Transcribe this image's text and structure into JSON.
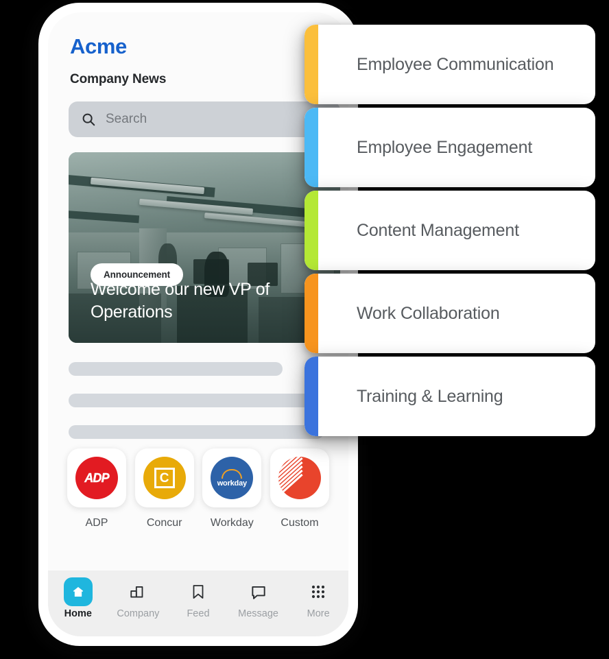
{
  "phone": {
    "app": {
      "brand": "Acme",
      "page_title": "Company News",
      "search": {
        "placeholder": "Search",
        "icon": "search-icon"
      },
      "hero": {
        "badge": "Announcement",
        "title": "Welcome our new VP of Operations",
        "image_description": "open-plan office interior, desaturated teal tint"
      },
      "skeleton_rows": 3,
      "apps": [
        {
          "label": "ADP",
          "logo": "adp-logo",
          "color": "#e21b22"
        },
        {
          "label": "Concur",
          "logo": "concur-logo",
          "color": "#e8aa09"
        },
        {
          "label": "Workday",
          "logo": "workday-logo",
          "color": "#2d62a8"
        },
        {
          "label": "Custom",
          "logo": "custom-logo",
          "color": "#e8442c"
        }
      ],
      "bottom_nav": {
        "active_index": 0,
        "active_color": "#1fb6de",
        "items": [
          {
            "label": "Home",
            "icon": "home-icon"
          },
          {
            "label": "Company",
            "icon": "building-icon"
          },
          {
            "label": "Feed",
            "icon": "bookmark-icon"
          },
          {
            "label": "Message",
            "icon": "chat-bubble-icon"
          },
          {
            "label": "More",
            "icon": "grid-dots-icon"
          }
        ]
      }
    }
  },
  "feature_cards": [
    {
      "label": "Employee Communication",
      "accent": "#fbbf3c"
    },
    {
      "label": "Employee Engagement",
      "accent": "#4cb9f5"
    },
    {
      "label": "Content Management",
      "accent": "#b4e835"
    },
    {
      "label": "Work Collaboration",
      "accent": "#f7941e"
    },
    {
      "label": "Training & Learning",
      "accent": "#3b73dd"
    }
  ],
  "theme": {
    "brand_blue": "#1661cc",
    "background": "#000000",
    "card_text": "#575b5f"
  }
}
